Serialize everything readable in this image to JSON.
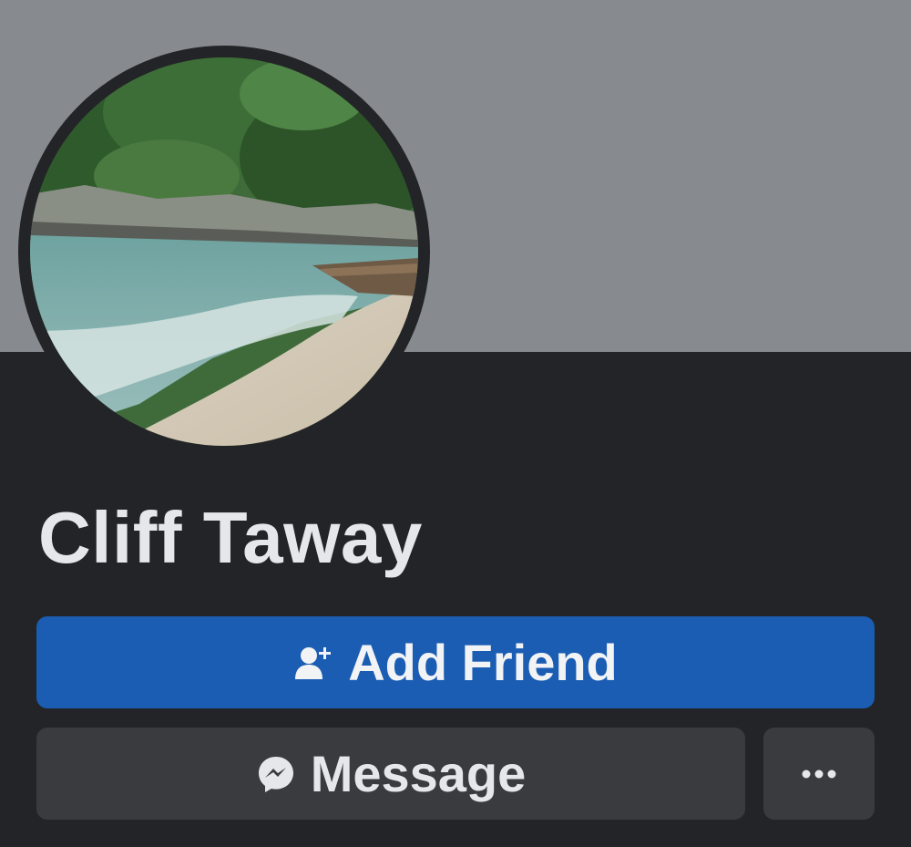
{
  "profile": {
    "name": "Cliff Taway"
  },
  "actions": {
    "add_friend_label": "Add Friend",
    "message_label": "Message"
  },
  "icons": {
    "add_friend": "add-person-icon",
    "message": "messenger-icon",
    "more": "ellipsis-icon"
  },
  "colors": {
    "cover": "#878b8f",
    "background": "#232427",
    "primary_button": "#1b5db3",
    "secondary_button": "#3a3b3e",
    "text": "#e6e7eb"
  }
}
